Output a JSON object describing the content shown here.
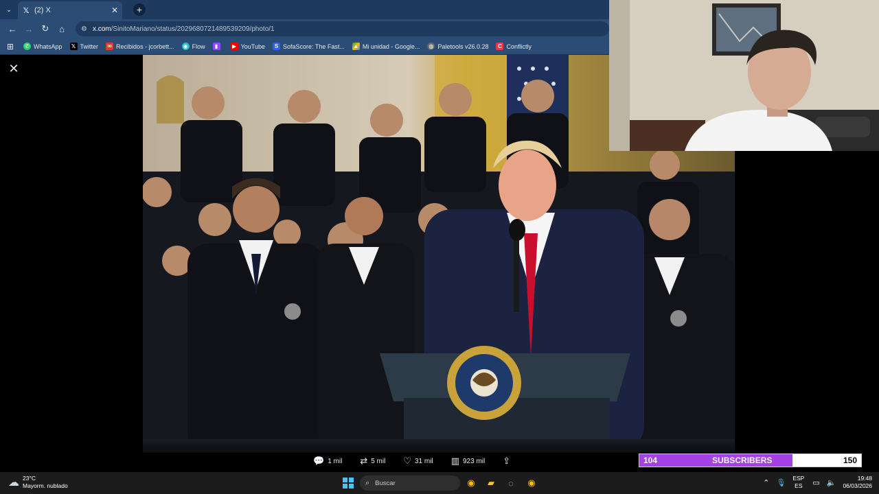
{
  "browser": {
    "tab": {
      "title": "(2) X",
      "favicon": "x-logo-icon"
    },
    "address": {
      "host": "x.com",
      "path": "/SinitoMariano/status/2029680721489539209/photo/1"
    },
    "bookmarks": [
      {
        "label": "WhatsApp",
        "icon": "whatsapp-icon",
        "color": "#25d366"
      },
      {
        "label": "Twitter",
        "icon": "x-logo-icon",
        "color": "#000000"
      },
      {
        "label": "Recibidos - jcorbett...",
        "icon": "mail-icon",
        "color": "#d23f31"
      },
      {
        "label": "Flow",
        "icon": "flow-icon",
        "color": "#21c0c6"
      },
      {
        "label": "",
        "icon": "twitch-icon",
        "color": "#9146ff"
      },
      {
        "label": "YouTube",
        "icon": "youtube-icon",
        "color": "#ff0000"
      },
      {
        "label": "SofaScore: The Fast...",
        "icon": "sofascore-icon",
        "color": "#2c64f0"
      },
      {
        "label": "Mi unidad - Google...",
        "icon": "drive-icon",
        "color": "#fbbc04"
      },
      {
        "label": "Paletools v26.0.28",
        "icon": "globe-icon",
        "color": "#6b6b6b"
      },
      {
        "label": "Conflictly",
        "icon": "conflictly-icon",
        "color": "#e63946"
      }
    ]
  },
  "post": {
    "actions": [
      {
        "name": "reply",
        "icon": "reply-icon",
        "count": "1 mil"
      },
      {
        "name": "repost",
        "icon": "repost-icon",
        "count": "5 mil"
      },
      {
        "name": "like",
        "icon": "heart-icon",
        "count": "31 mil"
      },
      {
        "name": "views",
        "icon": "views-icon",
        "count": "923 mil"
      }
    ]
  },
  "subscribers": {
    "current": "104",
    "label": "SUBSCRIBERS",
    "goal": "150",
    "fill_fraction": 0.69,
    "fill_color": "#a542e6"
  },
  "taskbar": {
    "weather": {
      "temp": "23°C",
      "desc": "Mayorm. nublado"
    },
    "search_placeholder": "Buscar",
    "lang_top": "ESP",
    "lang_bottom": "ES",
    "time": "19:48",
    "date": "06/03/2026"
  }
}
